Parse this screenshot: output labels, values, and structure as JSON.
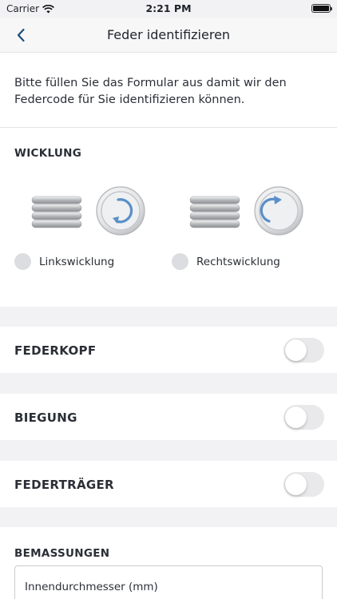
{
  "status_bar": {
    "carrier": "Carrier",
    "time": "2:21 PM"
  },
  "nav": {
    "title": "Feder identifizieren",
    "back_icon": "chevron-left-icon"
  },
  "intro": {
    "text": "Bitte füllen Sie das Formular aus damit wir den Federcode für Sie identifizieren können."
  },
  "wicklung": {
    "title": "WICKLUNG",
    "options": [
      {
        "label": "Linkswicklung",
        "icon": "left-winding-spring-icon",
        "selected": false
      },
      {
        "label": "Rechtswicklung",
        "icon": "right-winding-spring-icon",
        "selected": false
      }
    ]
  },
  "toggles": [
    {
      "label": "FEDERKOPF",
      "on": false
    },
    {
      "label": "BIEGUNG",
      "on": false
    },
    {
      "label": "FEDERTRÄGER",
      "on": false
    }
  ],
  "bemassungen": {
    "title": "BEMASSUNGEN",
    "fields": [
      {
        "label": "Innendurchmesser (mm)"
      }
    ]
  },
  "colors": {
    "accent": "#1e4c7a",
    "arrow_blue": "#5b8fc7",
    "background": "#f2f2f4"
  }
}
